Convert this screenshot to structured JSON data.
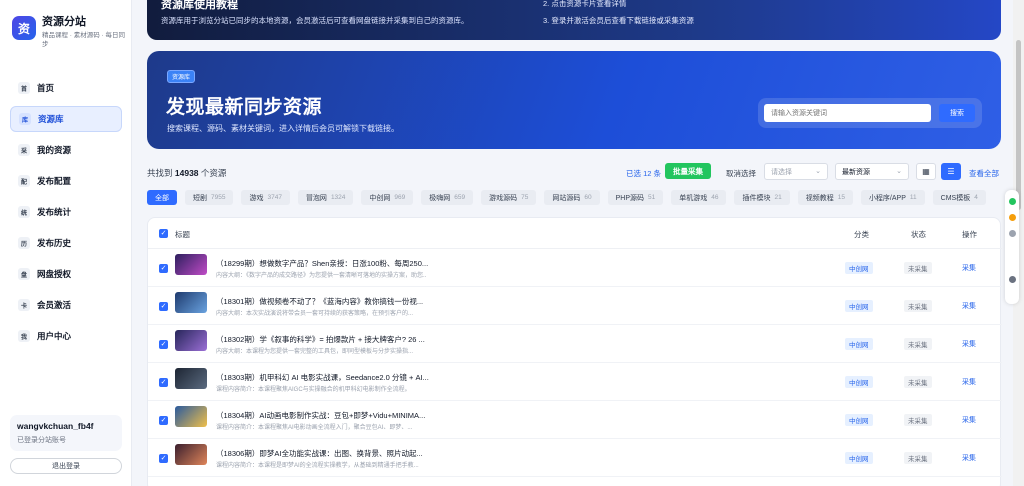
{
  "brand": {
    "logo_char": "资",
    "title": "资源分站",
    "subtitle": "精品课程 · 素材源码 · 每日同步"
  },
  "nav": [
    {
      "icon": "首",
      "label": "首页",
      "active": false,
      "name": "home"
    },
    {
      "icon": "库",
      "label": "资源库",
      "active": true,
      "name": "library"
    },
    {
      "icon": "采",
      "label": "我的资源",
      "active": false,
      "name": "my-resources"
    },
    {
      "icon": "配",
      "label": "发布配置",
      "active": false,
      "name": "publish-config"
    },
    {
      "icon": "统",
      "label": "发布统计",
      "active": false,
      "name": "publish-stats"
    },
    {
      "icon": "历",
      "label": "发布历史",
      "active": false,
      "name": "publish-history"
    },
    {
      "icon": "盘",
      "label": "网盘授权",
      "active": false,
      "name": "netdisk-auth"
    },
    {
      "icon": "卡",
      "label": "会员激活",
      "active": false,
      "name": "member-activation"
    },
    {
      "icon": "我",
      "label": "用户中心",
      "active": false,
      "name": "user-center"
    }
  ],
  "user": {
    "name": "wangvkchuan_fb4f",
    "status": "已登录分站账号",
    "logout_label": "退出登录"
  },
  "tutorial": {
    "title": "资源库使用教程",
    "desc": "资源库用于浏览分站已同步的本地资源，会员激活后可查看网盘链接并采集到自己的资源库。",
    "step2": "2. 点击资源卡片查看详情",
    "step3": "3. 登录并激活会员后查看下载链接或采集资源"
  },
  "hero": {
    "tag": "资源库",
    "title": "发现最新同步资源",
    "subtitle": "搜索课程、源码、素材关键词，进入详情后会员可解锁下载链接。",
    "search_placeholder": "请输入资源关键词",
    "search_button": "搜索"
  },
  "toolbar": {
    "count_prefix": "共找到",
    "count": "14938",
    "count_suffix": "个资源",
    "selected": "已选 12 条",
    "batch_button": "批量采集",
    "cancel_select": "取消选择",
    "select_placeholder": "请选择",
    "sort_value": "最新资源",
    "grid_icon": "▦",
    "list_icon": "☰",
    "view_all": "查看全部"
  },
  "categories": [
    {
      "label": "全部",
      "count": "",
      "active": true
    },
    {
      "label": "短剧",
      "count": "7955",
      "active": false
    },
    {
      "label": "游戏",
      "count": "3747",
      "active": false
    },
    {
      "label": "冒泡网",
      "count": "1324",
      "active": false
    },
    {
      "label": "中创网",
      "count": "969",
      "active": false
    },
    {
      "label": "极嗨网",
      "count": "659",
      "active": false
    },
    {
      "label": "游戏源码",
      "count": "75",
      "active": false
    },
    {
      "label": "网站源码",
      "count": "60",
      "active": false
    },
    {
      "label": "PHP源码",
      "count": "51",
      "active": false
    },
    {
      "label": "单机游戏",
      "count": "46",
      "active": false
    },
    {
      "label": "插件模块",
      "count": "21",
      "active": false
    },
    {
      "label": "视频教程",
      "count": "15",
      "active": false
    },
    {
      "label": "小程序/APP",
      "count": "11",
      "active": false
    },
    {
      "label": "CMS模板",
      "count": "4",
      "active": false
    }
  ],
  "table": {
    "headers": {
      "title": "标题",
      "category": "分类",
      "status": "状态",
      "action": "操作"
    },
    "rows": [
      {
        "title": "（18299期）想做数字产品？Shen亲授：日涨100粉、每周250...",
        "desc": "内容大纲：《数字产品的成交路径》为您提供一套清晰可落地的实操方案，助您...",
        "category": "中创网",
        "status": "未采集",
        "action": "采集",
        "thumb": [
          "#2d1f5e",
          "#c04cc7"
        ]
      },
      {
        "title": "（18301期）做视频卷不动了？《蓝海内容》教你搞钱一份视...",
        "desc": "内容大纲：本次实战演说将带会员一套可持续的获客策略，在预引客户的...",
        "category": "中创网",
        "status": "未采集",
        "action": "采集",
        "thumb": [
          "#1e3a6e",
          "#6aa3e0"
        ]
      },
      {
        "title": "（18302期）学《叙事的科学》= 拍爆款片 + 接大牌客户? 26 ...",
        "desc": "内容大纲：本课程为您提供一套完整的工具包，即同型模板与分步实操指...",
        "category": "中创网",
        "status": "未采集",
        "action": "采集",
        "thumb": [
          "#27265a",
          "#9b6fd6"
        ]
      },
      {
        "title": "（18303期）机甲科幻 AI 电影实战课，Seedance2.0 分镜 + AI...",
        "desc": "课程内容简介：本课程聚焦AIGC与实操融合的机甲科幻电影制作全流程。",
        "category": "中创网",
        "status": "未采集",
        "action": "采集",
        "thumb": [
          "#1d2533",
          "#5b6b80"
        ]
      },
      {
        "title": "（18304期）AI动画电影制作实战：豆包+即梦+Vidu+MINIMA...",
        "desc": "课程内容简介：本课程聚焦AI电影动画全流程入门，聚合豆包AI、即梦、...",
        "category": "中创网",
        "status": "未采集",
        "action": "采集",
        "thumb": [
          "#2a5a9e",
          "#f0c04a"
        ]
      },
      {
        "title": "（18306期）即梦AI全功能实战课：出图、换背景、照片动起...",
        "desc": "课程内容简介：本课程是即梦AI的全流程实操教学，从基础到精通手把手教...",
        "category": "中创网",
        "status": "未采集",
        "action": "采集",
        "thumb": [
          "#3a1f2e",
          "#e0865a"
        ]
      }
    ]
  }
}
